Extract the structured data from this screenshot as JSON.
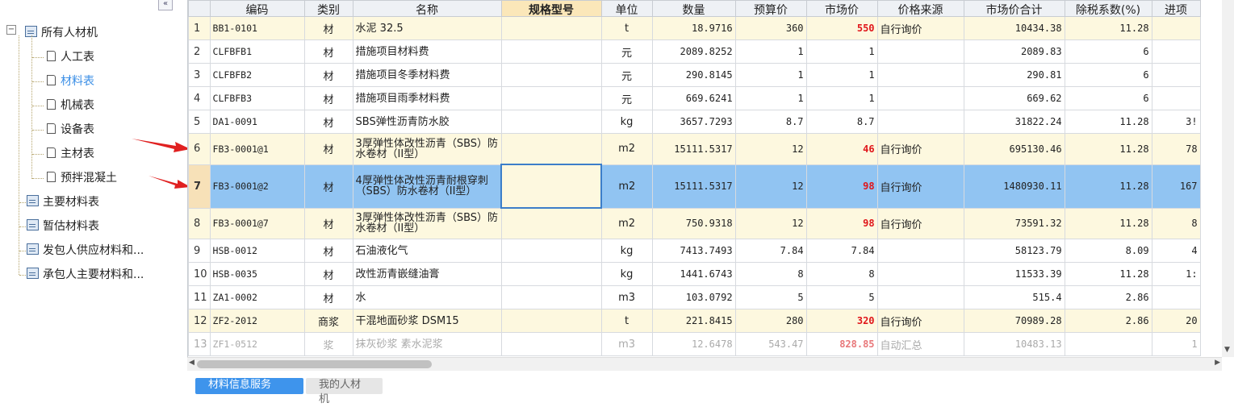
{
  "tree": {
    "collapse_symbol": "«",
    "root": {
      "toggle": "−",
      "label": "所有人材机"
    },
    "children": [
      {
        "label": "人工表"
      },
      {
        "label": "材料表"
      },
      {
        "label": "机械表"
      },
      {
        "label": "设备表"
      },
      {
        "label": "主材表"
      },
      {
        "label": "预拌混凝土"
      }
    ],
    "groups": [
      {
        "label": "主要材料表"
      },
      {
        "label": "暂估材料表"
      },
      {
        "label": "发包人供应材料和..."
      },
      {
        "label": "承包人主要材料和..."
      }
    ]
  },
  "colors": {
    "accent": "#3e94ec",
    "selected_row": "#91c4f2",
    "highlight_row": "#fdf8df",
    "red_value": "#e0161a",
    "arrow": "#e02020"
  },
  "grid": {
    "columns": [
      "",
      "编码",
      "类别",
      "名称",
      "规格型号",
      "单位",
      "数量",
      "预算价",
      "市场价",
      "价格来源",
      "市场价合计",
      "除税系数(%)",
      "进项"
    ],
    "rows": [
      {
        "idx": "1",
        "code": "BB1-0101",
        "type": "材",
        "name": "水泥 32.5",
        "spec": "",
        "unit": "t",
        "qty": "18.9716",
        "budget": "360",
        "market": "550",
        "source": "自行询价",
        "total": "10434.38",
        "coef": "11.28",
        "input": ""
      },
      {
        "idx": "2",
        "code": "CLFBFB1",
        "type": "材",
        "name": "措施项目材料费",
        "spec": "",
        "unit": "元",
        "qty": "2089.8252",
        "budget": "1",
        "market": "1",
        "source": "",
        "total": "2089.83",
        "coef": "6",
        "input": ""
      },
      {
        "idx": "3",
        "code": "CLFBFB2",
        "type": "材",
        "name": "措施项目冬季材料费",
        "spec": "",
        "unit": "元",
        "qty": "290.8145",
        "budget": "1",
        "market": "1",
        "source": "",
        "total": "290.81",
        "coef": "6",
        "input": ""
      },
      {
        "idx": "4",
        "code": "CLFBFB3",
        "type": "材",
        "name": "措施项目雨季材料费",
        "spec": "",
        "unit": "元",
        "qty": "669.6241",
        "budget": "1",
        "market": "1",
        "source": "",
        "total": "669.62",
        "coef": "6",
        "input": ""
      },
      {
        "idx": "5",
        "code": "DA1-0091",
        "type": "材",
        "name": "SBS弹性沥青防水胶",
        "spec": "",
        "unit": "kg",
        "qty": "3657.7293",
        "budget": "8.7",
        "market": "8.7",
        "source": "",
        "total": "31822.24",
        "coef": "11.28",
        "input": "3!"
      },
      {
        "idx": "6",
        "code": "FB3-0001@1",
        "type": "材",
        "name": "3厚弹性体改性沥青（SBS）防水卷材（II型）",
        "spec": "",
        "unit": "m2",
        "qty": "15111.5317",
        "budget": "12",
        "market": "46",
        "source": "自行询价",
        "total": "695130.46",
        "coef": "11.28",
        "input": "78"
      },
      {
        "idx": "7",
        "code": "FB3-0001@2",
        "type": "材",
        "name": "4厚弹性体改性沥青耐根穿刺（SBS）防水卷材（II型）",
        "spec": "",
        "unit": "m2",
        "qty": "15111.5317",
        "budget": "12",
        "market": "98",
        "source": "自行询价",
        "total": "1480930.11",
        "coef": "11.28",
        "input": "167"
      },
      {
        "idx": "8",
        "code": "FB3-0001@7",
        "type": "材",
        "name": "3厚弹性体改性沥青（SBS）防水卷材（II型）",
        "spec": "",
        "unit": "m2",
        "qty": "750.9318",
        "budget": "12",
        "market": "98",
        "source": "自行询价",
        "total": "73591.32",
        "coef": "11.28",
        "input": "8"
      },
      {
        "idx": "9",
        "code": "HSB-0012",
        "type": "材",
        "name": "石油液化气",
        "spec": "",
        "unit": "kg",
        "qty": "7413.7493",
        "budget": "7.84",
        "market": "7.84",
        "source": "",
        "total": "58123.79",
        "coef": "8.09",
        "input": "4"
      },
      {
        "idx": "10",
        "code": "HSB-0035",
        "type": "材",
        "name": "改性沥青嵌缝油膏",
        "spec": "",
        "unit": "kg",
        "qty": "1441.6743",
        "budget": "8",
        "market": "8",
        "source": "",
        "total": "11533.39",
        "coef": "11.28",
        "input": "1:"
      },
      {
        "idx": "11",
        "code": "ZA1-0002",
        "type": "材",
        "name": "水",
        "spec": "",
        "unit": "m3",
        "qty": "103.0792",
        "budget": "5",
        "market": "5",
        "source": "",
        "total": "515.4",
        "coef": "2.86",
        "input": ""
      },
      {
        "idx": "12",
        "code": "ZF2-2012",
        "type": "商浆",
        "name": "干混地面砂浆 DSM15",
        "spec": "",
        "unit": "t",
        "qty": "221.8415",
        "budget": "280",
        "market": "320",
        "source": "自行询价",
        "total": "70989.28",
        "coef": "2.86",
        "input": "20"
      },
      {
        "idx": "13",
        "code": "ZF1-0512",
        "type": "浆",
        "name": "抹灰砂浆 素水泥浆",
        "spec": "",
        "unit": "m3",
        "qty": "12.6478",
        "budget": "543.47",
        "market": "828.85",
        "source": "自动汇总",
        "total": "10483.13",
        "coef": "",
        "input": "1"
      }
    ]
  },
  "bottom_tabs": [
    "材料信息服务",
    "我的人材机"
  ]
}
